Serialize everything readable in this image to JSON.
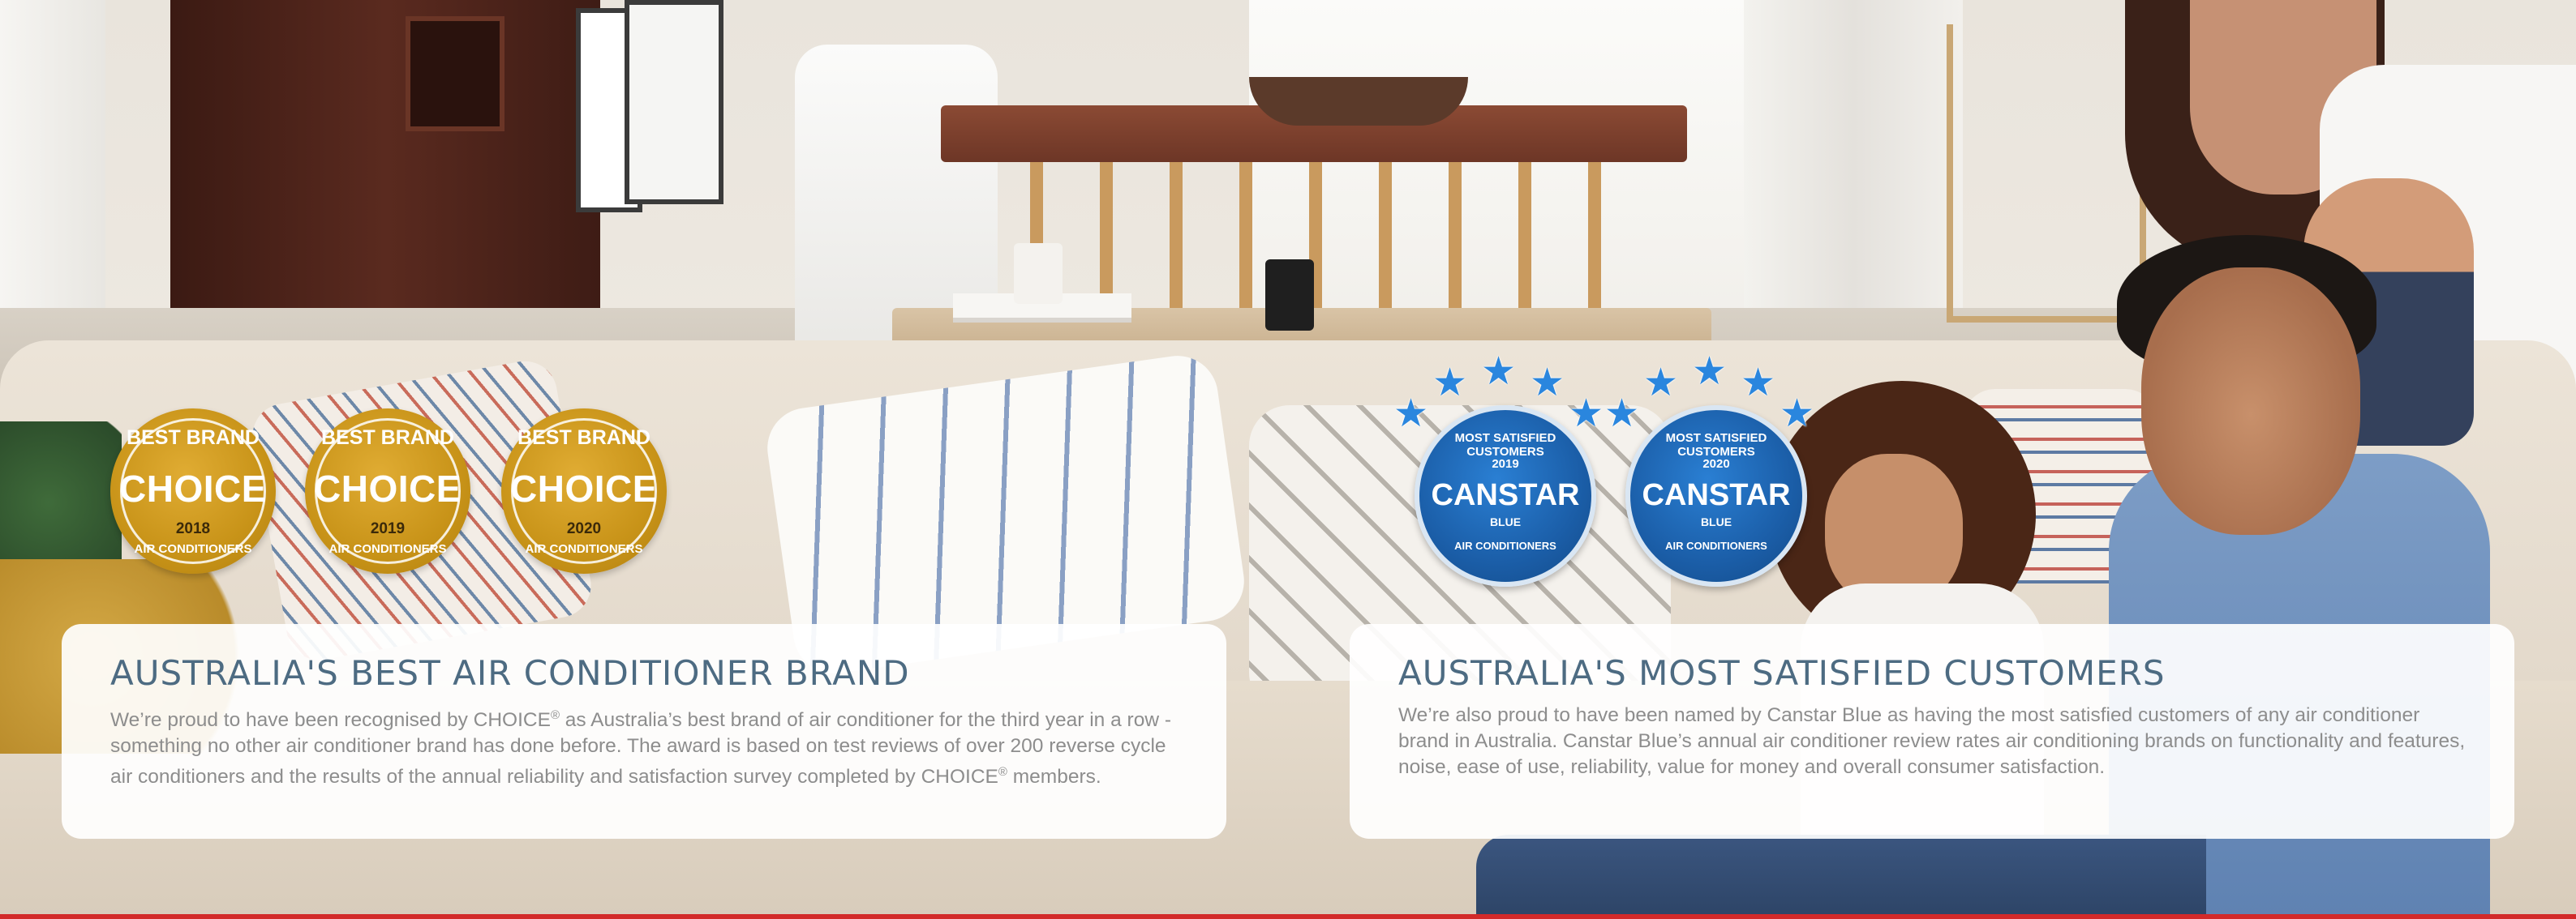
{
  "awards": {
    "choice": [
      {
        "top": "BEST BRAND",
        "word": "CHOICE",
        "year": "2018",
        "bottom": "AIR CONDITIONERS"
      },
      {
        "top": "BEST BRAND",
        "word": "CHOICE",
        "year": "2019",
        "bottom": "AIR CONDITIONERS"
      },
      {
        "top": "BEST BRAND",
        "word": "CHOICE",
        "year": "2020",
        "bottom": "AIR CONDITIONERS"
      }
    ],
    "canstar": [
      {
        "top": "MOST SATISFIED CUSTOMERS",
        "year": "2019",
        "word": "CANSTAR",
        "sub": "BLUE",
        "bottom": "AIR CONDITIONERS"
      },
      {
        "top": "MOST SATISFIED CUSTOMERS",
        "year": "2020",
        "word": "CANSTAR",
        "sub": "BLUE",
        "bottom": "AIR CONDITIONERS"
      }
    ]
  },
  "cards": {
    "left": {
      "title": "AUSTRALIA'S BEST AIR CONDITIONER BRAND",
      "body_part1": "We’re proud to have been recognised by CHOICE",
      "reg1": "®",
      "body_part2": " as Australia’s best brand of air conditioner for the third year in a row - something no other air conditioner brand has done before. The award is based on test reviews of over 200 reverse cycle air conditioners and the results of the annual reliability and satisfaction survey completed by CHOICE",
      "reg2": "®",
      "body_part3": " members."
    },
    "right": {
      "title": "AUSTRALIA'S MOST SATISFIED CUSTOMERS",
      "body": "We’re also proud to have been named by Canstar Blue as having the most satisfied customers of any air conditioner brand in Australia. Canstar Blue’s annual air conditioner review rates air conditioning brands on functionality and features, noise, ease of use, reliability, value for money and overall consumer satisfaction."
    }
  },
  "colors": {
    "title": "#4d6b82",
    "body_text": "#8d8d8d",
    "gold": "#c89318",
    "canstar_blue": "#1b5ea8",
    "accent_red": "#d22a2a"
  }
}
